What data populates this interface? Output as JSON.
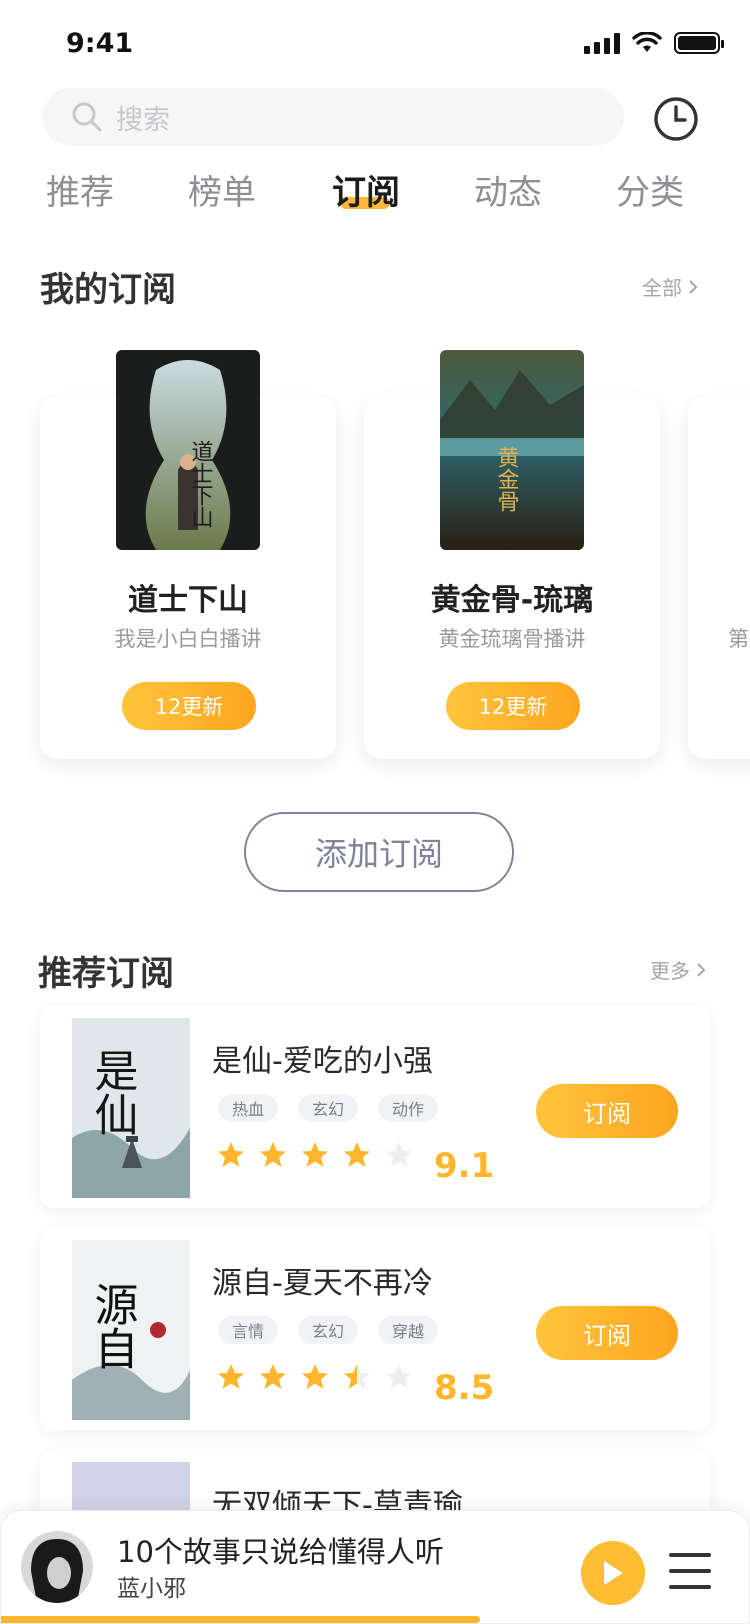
{
  "status_bar": {
    "time": "9:41"
  },
  "search": {
    "placeholder": "搜索"
  },
  "tabs": [
    {
      "label": "推荐",
      "active": false
    },
    {
      "label": "榜单",
      "active": false
    },
    {
      "label": "订阅",
      "active": true
    },
    {
      "label": "动态",
      "active": false
    },
    {
      "label": "分类",
      "active": false
    }
  ],
  "my_subscriptions": {
    "title": "我的订阅",
    "more": "全部",
    "items": [
      {
        "name": "道士下山",
        "narrator": "我是小白白播讲",
        "update": "12更新",
        "cover_title": "道士下山"
      },
      {
        "name": "黄金骨-琉璃",
        "narrator": "黄金琉璃骨播讲",
        "update": "12更新",
        "cover_title": "黄金骨"
      },
      {
        "name": "",
        "narrator": "第",
        "update": "",
        "cover_title": ""
      }
    ],
    "add_button": "添加订阅"
  },
  "recommend": {
    "title": "推荐订阅",
    "more": "更多",
    "items": [
      {
        "title": "是仙-爱吃的小强",
        "tags": [
          "热血",
          "玄幻",
          "动作"
        ],
        "rating": 4,
        "score": "9.1",
        "button": "订阅",
        "cover_title": "是仙"
      },
      {
        "title": "源自-夏天不再冷",
        "tags": [
          "言情",
          "玄幻",
          "穿越"
        ],
        "rating": 3.5,
        "score": "8.5",
        "button": "订阅",
        "cover_title": "源自"
      },
      {
        "title": "无双倾天下-莫青瑜",
        "tags": [],
        "rating": null,
        "score": "",
        "button": "",
        "cover_title": ""
      }
    ]
  },
  "player": {
    "title": "10个故事只说给懂得人听",
    "artist": "蓝小邪",
    "progress": 0.64
  },
  "colors": {
    "accent": "#ffb023",
    "accent_light": "#ffc43d",
    "text_muted": "#8e8e93",
    "outline": "#7d8398"
  }
}
